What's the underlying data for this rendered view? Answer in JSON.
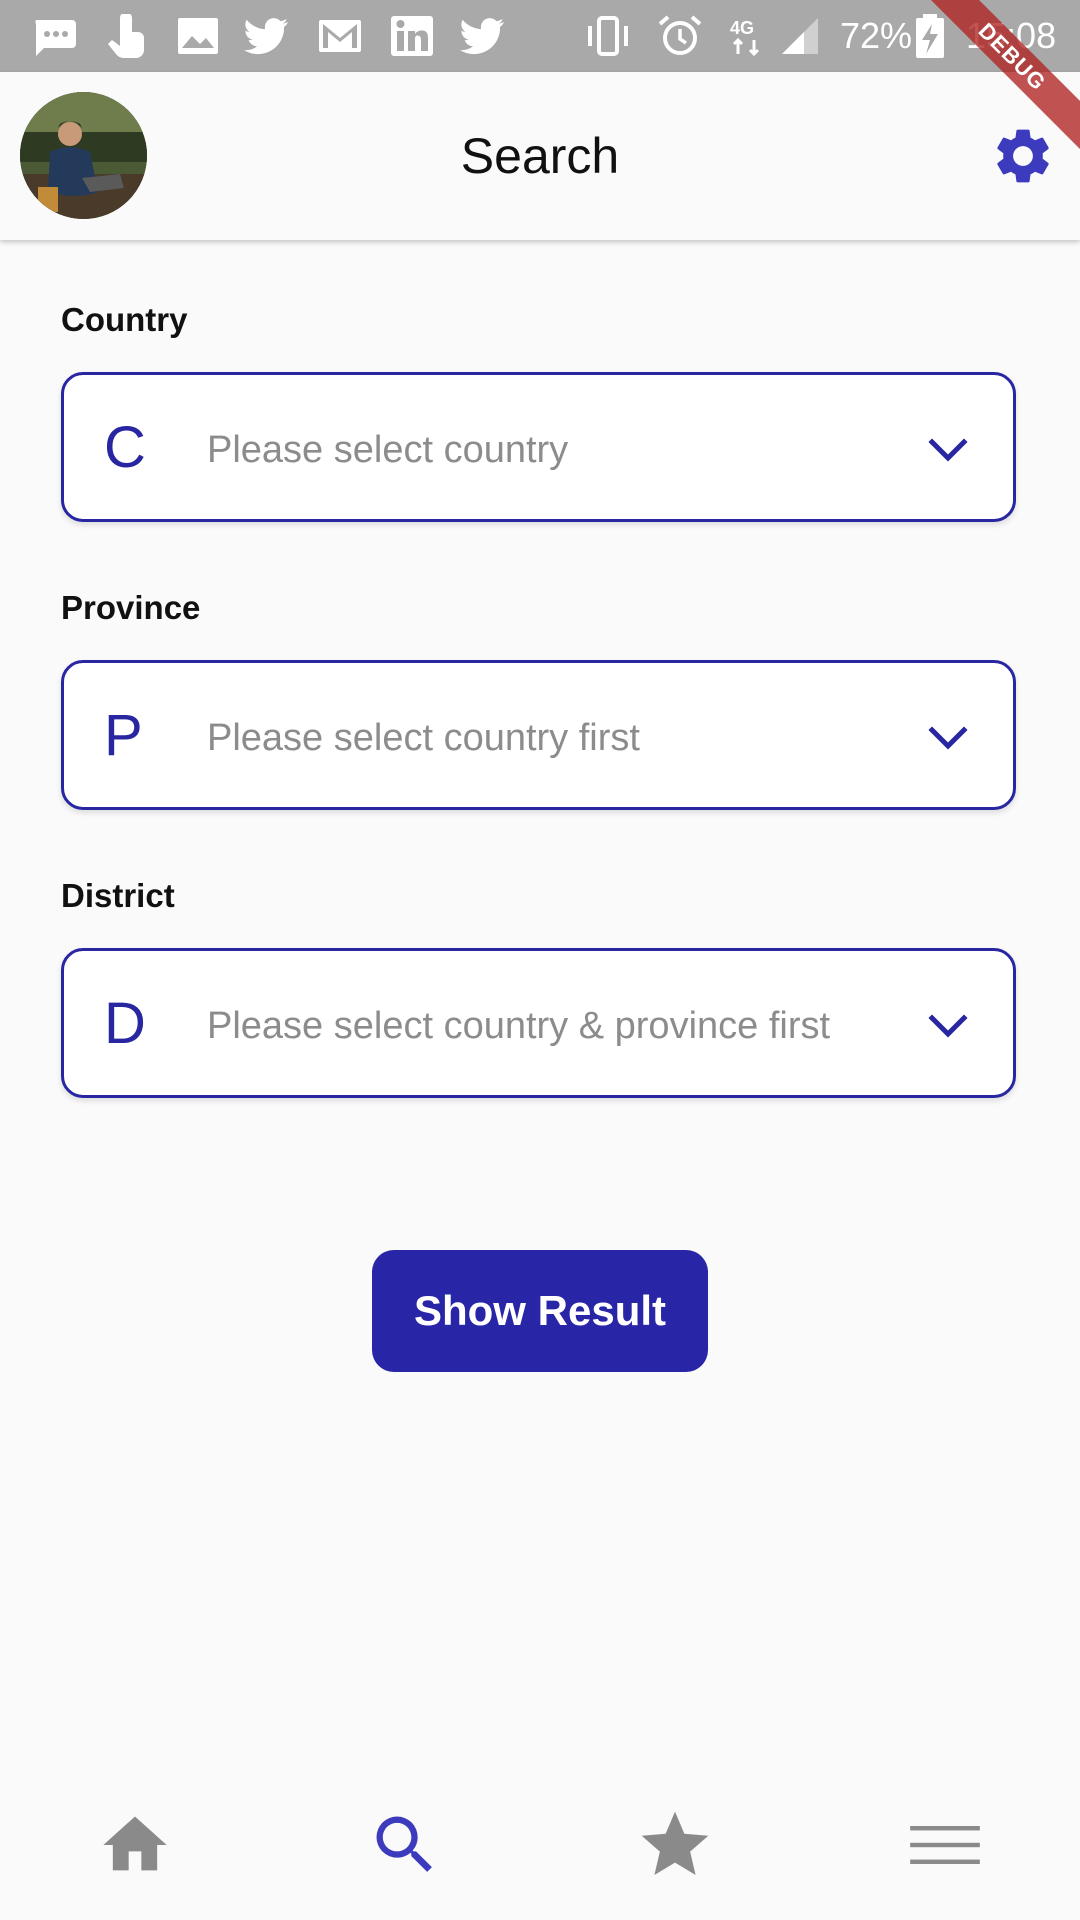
{
  "status_bar": {
    "battery": "72%",
    "time": "15:08",
    "network": "4G",
    "debug_banner": "DEBUG",
    "notification_icons": [
      "chat-icon",
      "touch-icon",
      "image-icon",
      "twitter-icon",
      "gmail-icon",
      "linkedin-icon",
      "twitter-icon"
    ],
    "system_icons": [
      "vibrate-icon",
      "alarm-icon",
      "network-4g-icon",
      "signal-icon",
      "battery-icon"
    ]
  },
  "app_bar": {
    "title": "Search",
    "avatar": "avatar-icon",
    "settings_icon": "gear-icon"
  },
  "form": {
    "country": {
      "label": "Country",
      "letter": "C",
      "placeholder": "Please select country"
    },
    "province": {
      "label": "Province",
      "letter": "P",
      "placeholder": "Please select country first"
    },
    "district": {
      "label": "District",
      "letter": "D",
      "placeholder": "Please select country & province first"
    },
    "submit_label": "Show Result"
  },
  "bottom_nav": {
    "items": [
      {
        "icon": "home-icon",
        "active": false
      },
      {
        "icon": "search-icon",
        "active": true
      },
      {
        "icon": "star-icon",
        "active": false
      },
      {
        "icon": "menu-icon",
        "active": false
      }
    ]
  },
  "colors": {
    "accent": "#2826a6",
    "active_nav": "#3d3bbd",
    "inactive_nav": "#8a8a8a",
    "status_bar": "#a9a9a9",
    "background": "#fafafa",
    "debug_ribbon": "#b02222"
  }
}
